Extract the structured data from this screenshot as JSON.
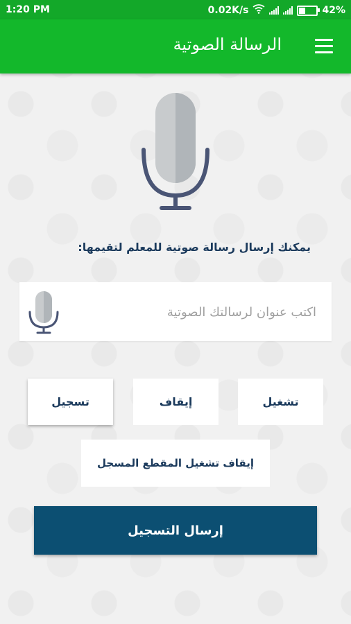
{
  "status_bar": {
    "time": "1:20 PM",
    "network_speed": "0.02K/s",
    "battery_percent": "42%",
    "battery_level": 0.42,
    "icons": [
      "wifi-icon",
      "signal-icon",
      "signal-icon",
      "battery-icon"
    ]
  },
  "app_bar": {
    "title": "الرسالة الصوتية",
    "menu_icon": "hamburger-menu-icon",
    "color": "#13b82b"
  },
  "main": {
    "hero_icon": "microphone-icon",
    "instruction": "يمكنك إرسال رسالة صوتية للمعلم لتقيمها:",
    "title_input": {
      "value": "",
      "placeholder": "اكتب عنوان لرسالتك الصوتية",
      "icon": "microphone-icon"
    },
    "controls": {
      "record_label": "تسجيل",
      "stop_label": "إيقاف",
      "play_label": "تشغيل",
      "stop_playback_label": "إيقاف تشغيل المقطع المسجل"
    },
    "send_label": "إرسال التسجيل",
    "send_color": "#0c4f72"
  }
}
